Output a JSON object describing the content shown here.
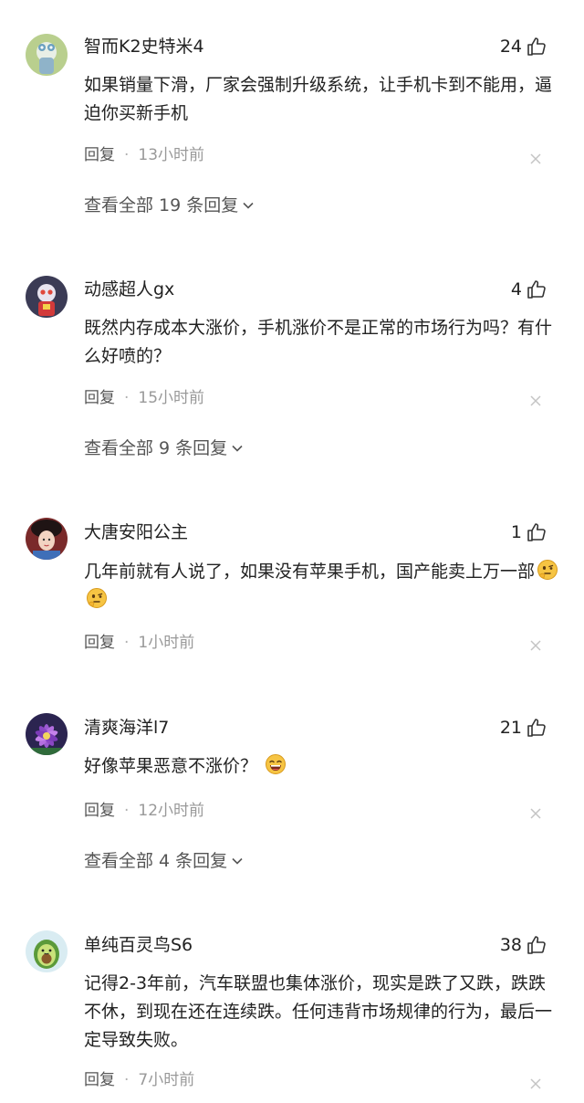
{
  "comments": [
    {
      "username": "智而K2史特米4",
      "likes": "24",
      "text": "如果销量下滑，厂家会强制升级系统，让手机卡到不能用，逼迫你买新手机",
      "reply_label": "回复",
      "separator": "·",
      "time": "13小时前",
      "view_replies": "查看全部 19 条回复"
    },
    {
      "username": "动感超人gx",
      "likes": "4",
      "text": "既然内存成本大涨价，手机涨价不是正常的市场行为吗？有什么好喷的？",
      "reply_label": "回复",
      "separator": "·",
      "time": "15小时前",
      "view_replies": "查看全部 9 条回复"
    },
    {
      "username": "大唐安阳公主",
      "likes": "1",
      "text": "几年前就有人说了，如果没有苹果手机，国产能卖上万一部",
      "emojis": [
        "thinking-emoji",
        "thinking-emoji"
      ],
      "reply_label": "回复",
      "separator": "·",
      "time": "1小时前"
    },
    {
      "username": "清爽海洋l7",
      "likes": "21",
      "text": "好像苹果恶意不涨价？",
      "emojis": [
        "laughing-emoji"
      ],
      "reply_label": "回复",
      "separator": "·",
      "time": "12小时前",
      "view_replies": "查看全部 4 条回复"
    },
    {
      "username": "单纯百灵鸟S6",
      "likes": "38",
      "text": "记得2-3年前，汽车联盟也集体涨价，现实是跌了又跌，跌跌不休，到现在还在连续跌。任何违背市场规律的行为，最后一定导致失败。",
      "reply_label": "回复",
      "separator": "·",
      "time": "7小时前"
    }
  ],
  "icons": {
    "like": "thumb-up-icon",
    "dismiss": "close-icon",
    "expand": "chevron-down-icon"
  },
  "colors": {
    "text_primary": "#222222",
    "text_secondary": "#555555",
    "text_muted": "#999999",
    "background": "#ffffff"
  }
}
